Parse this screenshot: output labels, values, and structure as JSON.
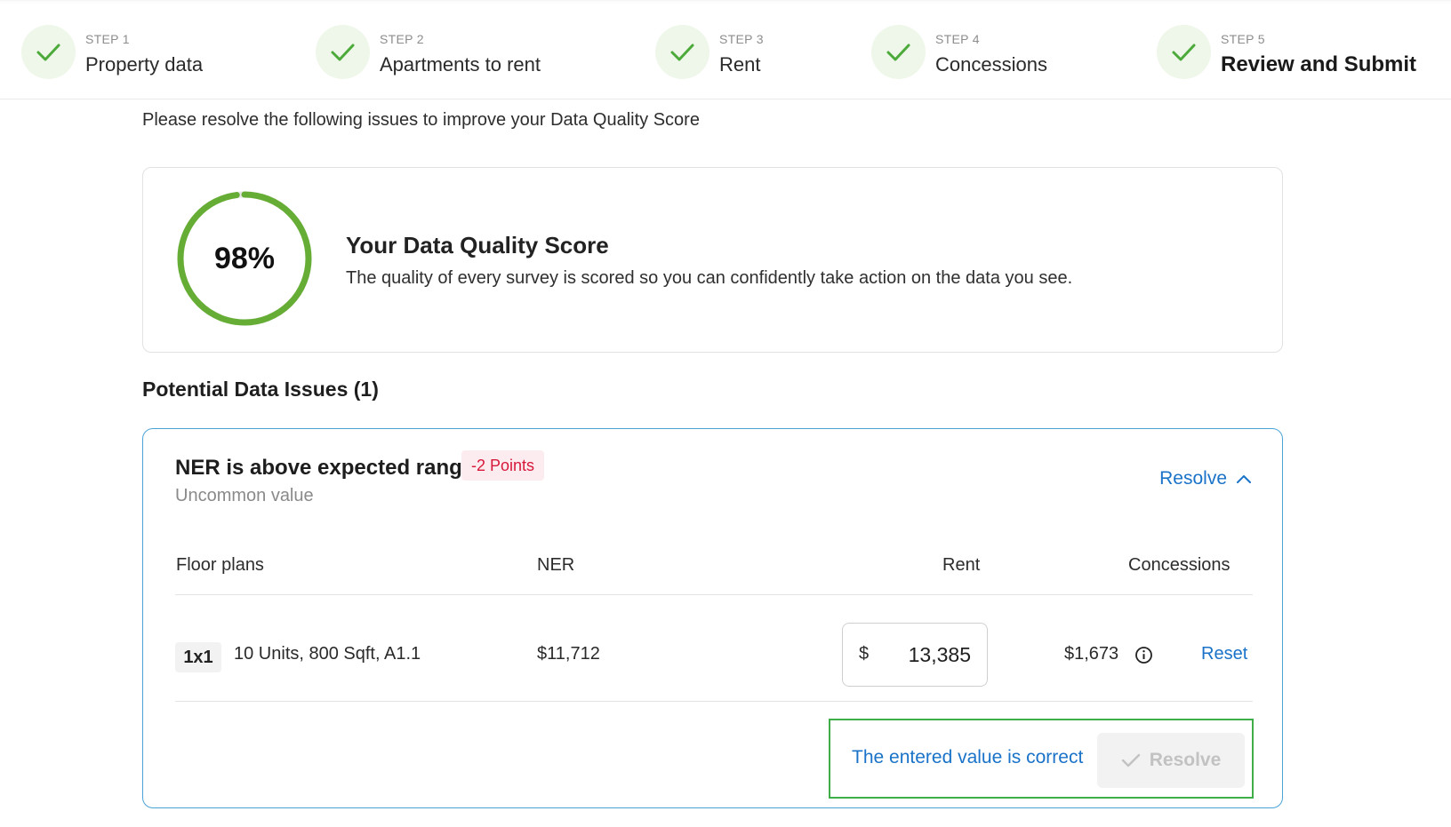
{
  "stepper": {
    "steps": [
      {
        "number": "STEP 1",
        "label": "Property data"
      },
      {
        "number": "STEP 2",
        "label": "Apartments to rent"
      },
      {
        "number": "STEP 3",
        "label": "Rent"
      },
      {
        "number": "STEP 4",
        "label": "Concessions"
      },
      {
        "number": "STEP 5",
        "label": "Review and Submit"
      }
    ],
    "active_step": 5,
    "completed_icon": "check-icon",
    "check_color": "#4caa3a"
  },
  "intro": "Please resolve the following issues to improve your Data Quality Score",
  "score": {
    "value": "98%",
    "percent": 98,
    "title": "Your Data Quality Score",
    "description": "The quality of every survey is scored so you can confidently take action on the data you see.",
    "ring_color": "#66ad35"
  },
  "issues": {
    "heading": "Potential Data Issues (1)",
    "items": [
      {
        "title": "NER is above expected range",
        "points": "-2 Points",
        "subtitle": "Uncommon value",
        "toggle_label": "Resolve",
        "toggle_icon": "chevron-up-icon",
        "columns": {
          "floor_plans": "Floor plans",
          "ner": "NER",
          "rent": "Rent",
          "concessions": "Concessions"
        },
        "row": {
          "plan": "1x1",
          "details": "10 Units, 800 Sqft, A1.1",
          "ner": "$11,712",
          "rent_currency": "$",
          "rent_value": "13,385",
          "concessions": "$1,673",
          "info_icon": "info-icon",
          "reset_label": "Reset"
        },
        "confirm_label": "The entered value is correct",
        "resolve_button": "Resolve"
      }
    ]
  },
  "colors": {
    "link": "#1a73c8",
    "badge_text": "#d6173a",
    "badge_bg": "#fdecef",
    "card_border": "#4aa3d6",
    "confirm_border": "#3fae49"
  }
}
